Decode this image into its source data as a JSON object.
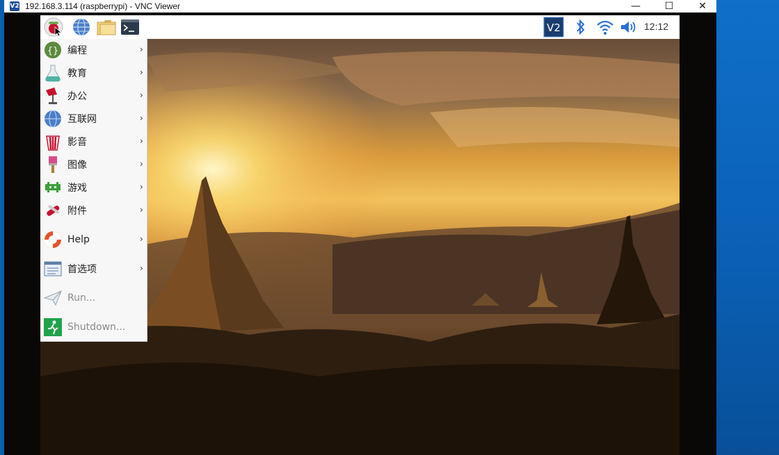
{
  "window": {
    "title": "192.168.3.114 (raspberrypi) - VNC Viewer",
    "app_icon_text": "V2",
    "minimize": "—",
    "maximize": "☐",
    "close": "✕"
  },
  "panel": {
    "clock": "12:12",
    "icons": [
      "raspberry-menu-icon",
      "web-browser-icon",
      "file-manager-icon",
      "terminal-icon",
      "vnc-server-icon",
      "bluetooth-icon",
      "wifi-icon",
      "volume-icon"
    ]
  },
  "menu": {
    "items": [
      {
        "label": "编程",
        "icon": "programming-icon",
        "submenu": true
      },
      {
        "label": "教育",
        "icon": "education-icon",
        "submenu": true
      },
      {
        "label": "办公",
        "icon": "office-icon",
        "submenu": true
      },
      {
        "label": "互联网",
        "icon": "internet-icon",
        "submenu": true
      },
      {
        "label": "影音",
        "icon": "sound-video-icon",
        "submenu": true
      },
      {
        "label": "图像",
        "icon": "graphics-icon",
        "submenu": true
      },
      {
        "label": "游戏",
        "icon": "games-icon",
        "submenu": true
      },
      {
        "label": "附件",
        "icon": "accessories-icon",
        "submenu": true
      },
      {
        "label": "Help",
        "icon": "help-icon",
        "submenu": true
      },
      {
        "label": "首选项",
        "icon": "preferences-icon",
        "submenu": true
      },
      {
        "label": "Run...",
        "icon": "run-icon",
        "submenu": false
      },
      {
        "label": "Shutdown...",
        "icon": "shutdown-icon",
        "submenu": false
      }
    ],
    "arrow": "›"
  },
  "colors": {
    "accent_vnc": "#1a3c6e",
    "wallpaper_sky": "#d08a2e",
    "wallpaper_ground": "#2a1a0c",
    "windows_blue": "#0c64b8"
  }
}
